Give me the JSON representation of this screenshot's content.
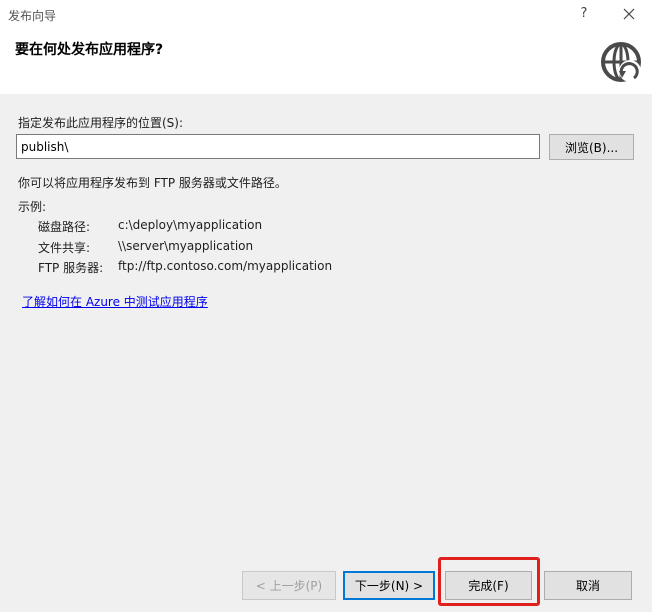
{
  "window": {
    "title": "发布向导",
    "help_label": "?"
  },
  "header": {
    "title": "要在何处发布应用程序?",
    "icon": "globe-publish-icon"
  },
  "form": {
    "location_label": "指定发布此应用程序的位置(S):",
    "location_value": "publish\\",
    "browse_label": "浏览(B)...",
    "description": "你可以将应用程序发布到 FTP 服务器或文件路径。",
    "examples_label": "示例:",
    "examples": [
      {
        "label": "磁盘路径:",
        "value": "c:\\deploy\\myapplication"
      },
      {
        "label": "文件共享:",
        "value": "\\\\server\\myapplication"
      },
      {
        "label": "FTP 服务器:",
        "value": "ftp://ftp.contoso.com/myapplication"
      }
    ],
    "azure_link": "了解如何在 Azure 中测试应用程序"
  },
  "footer": {
    "prev_label": "< 上一步(P)",
    "next_label": "下一步(N) >",
    "finish_label": "完成(F)",
    "cancel_label": "取消",
    "highlight_color": "#e0201c"
  }
}
